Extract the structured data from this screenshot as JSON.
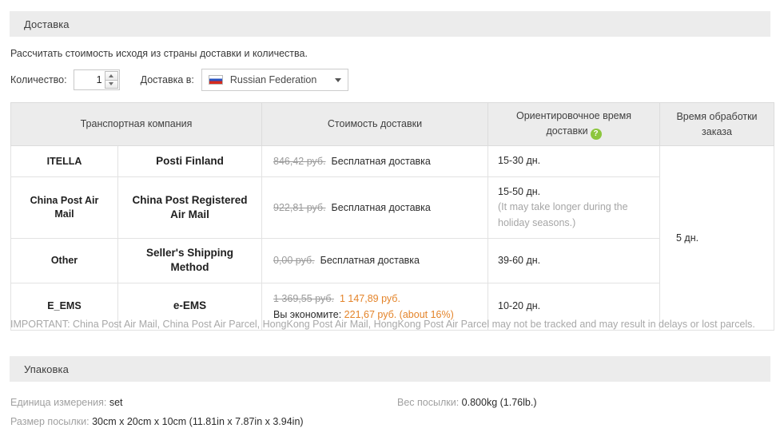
{
  "delivery": {
    "section_title": "Доставка",
    "intro": "Рассчитать стоимость исходя из страны доставки и количества.",
    "quantity_label": "Количество:",
    "quantity_value": "1",
    "quantity_placeholder": "1",
    "ship_to_label": "Доставка в:",
    "country": "Russian Federation",
    "flag_icon": "russian-federation-flag-icon",
    "spinner_up_icon": "chevron-up-icon",
    "spinner_down_icon": "chevron-down-icon",
    "dropdown_icon": "chevron-down-icon",
    "columns": [
      "Транспортная компания",
      "",
      "Стоимость доставки",
      "Ориентировочное время доставки",
      "Время обработки заказа"
    ],
    "help_icon": "help-question-icon",
    "help_icon_glyph": "?",
    "accent_color": "#e4842a",
    "help_icon_color": "#8cc63e",
    "rows": [
      {
        "code": "ITELLA",
        "name": "Posti Finland",
        "old_price": "846,42 руб.",
        "price_text": "Бесплатная доставка",
        "new_price": "",
        "save_label": "",
        "save_value": "",
        "time": "15-30 дн.",
        "time_note": ""
      },
      {
        "code": "China Post Air Mail",
        "name": "China Post Registered Air Mail",
        "old_price": "922,81 руб.",
        "price_text": "Бесплатная доставка",
        "new_price": "",
        "save_label": "",
        "save_value": "",
        "time": "15-50 дн.",
        "time_note": "(It may take longer during the holiday seasons.)"
      },
      {
        "code": "Other",
        "name": "Seller's Shipping Method",
        "old_price": "0,00 руб.",
        "price_text": "Бесплатная доставка",
        "new_price": "",
        "save_label": "",
        "save_value": "",
        "time": "39-60 дн.",
        "time_note": ""
      },
      {
        "code": "E_EMS",
        "name": "e-EMS",
        "old_price": "1 369,55 руб.",
        "price_text": "",
        "new_price": "1 147,89 руб.",
        "save_label": "Вы экономите:",
        "save_value": "221,67 руб. (about 16%)",
        "time": "10-20 дн.",
        "time_note": ""
      }
    ],
    "processing_time": "5 дн.",
    "important_notice": "IMPORTANT: China Post Air Mail, China Post Air Parcel, HongKong Post Air Mail, HongKong Post Air Parcel may not be tracked and may result in delays or lost parcels."
  },
  "packaging": {
    "section_title": "Упаковка",
    "unit_label": "Единица измерения:",
    "unit_value": "set",
    "weight_label": "Вес посылки:",
    "weight_value": "0.800kg (1.76lb.)",
    "size_label": "Размер посылки:",
    "size_value": "30cm x 20cm x 10cm (11.81in x 7.87in x 3.94in)"
  }
}
